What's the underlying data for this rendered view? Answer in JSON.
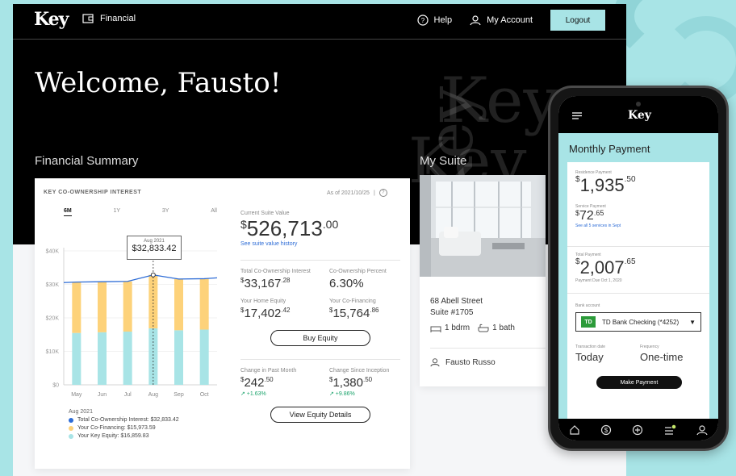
{
  "nav": {
    "logo": "Key",
    "section": "Financial",
    "help": "Help",
    "account": "My Account",
    "logout": "Logout"
  },
  "welcome": "Welcome, Fausto!",
  "watermark": "Key",
  "financial_summary": {
    "title": "Financial Summary",
    "chart_title": "KEY CO-OWNERSHIP INTEREST",
    "as_of": "As of 2021/10/25",
    "separator": "|",
    "info_icon": "?",
    "tabs": [
      "6M",
      "1Y",
      "3Y",
      "All"
    ],
    "active_tab": "6M",
    "tooltip": {
      "date": "Aug 2021",
      "value": "$32,833.42"
    },
    "legend": {
      "title": "Aug 2021",
      "items": [
        "Total Co-Ownership Interest: $32,833.42",
        "Your Co-Financing: $15,973.59",
        "Your Key Equity: $16,859.83"
      ]
    },
    "current_suite_value": {
      "label": "Current Suite Value",
      "dollar": "$",
      "whole": "526,713",
      "cents": ".00",
      "link": "See suite value history"
    },
    "total_co_ownership_interest": {
      "label": "Total Co-Ownership Interest",
      "dollar": "$",
      "whole": "33,167",
      "cents": ".28"
    },
    "co_ownership_percent": {
      "label": "Co-Ownership Percent",
      "value": "6.30%"
    },
    "your_home_equity": {
      "label": "Your Home Equity",
      "dollar": "$",
      "whole": "17,402",
      "cents": ".42"
    },
    "your_co_financing": {
      "label": "Your Co-Financing",
      "dollar": "$",
      "whole": "15,764",
      "cents": ".86"
    },
    "buy_equity_label": "Buy Equity",
    "change_past_month": {
      "label": "Change in Past Month",
      "dollar": "$",
      "whole": "242",
      "cents": ".50",
      "change": "↗ +1.63%"
    },
    "change_since_inception": {
      "label": "Change Since Inception",
      "dollar": "$",
      "whole": "1,380",
      "cents": ".50",
      "change": "↗ +9.86%"
    },
    "view_equity_label": "View Equity Details"
  },
  "chart_data": {
    "type": "bar",
    "categories": [
      "May",
      "Jun",
      "Jul",
      "Aug",
      "Sep",
      "Oct"
    ],
    "series": [
      {
        "name": "Your Key Equity",
        "values": [
          15500,
          15700,
          15900,
          16859.83,
          16300,
          16500
        ]
      },
      {
        "name": "Your Co-Financing",
        "values": [
          15200,
          15100,
          15000,
          15973.59,
          15300,
          15200
        ]
      },
      {
        "name": "Total Co-Ownership Interest",
        "values": [
          30700,
          30800,
          30900,
          32833.42,
          31600,
          31700
        ]
      }
    ],
    "y_ticks": [
      "$0",
      "$10K",
      "$20K",
      "$30K",
      "$40K"
    ],
    "ylim": [
      0,
      40000
    ],
    "colors": {
      "key_equity": "#a8e4e6",
      "co_financing": "#fdd27a",
      "total": "#2d6cd6"
    },
    "highlight": "Aug"
  },
  "suite": {
    "title": "My Suite",
    "address_line1": "68 Abell Street",
    "address_line2": "Suite #1705",
    "bedrooms": "1 bdrm",
    "bathrooms": "1 bath",
    "owner": "Fausto Russo"
  },
  "phone": {
    "logo": "Key",
    "title": "Monthly Payment",
    "residence": {
      "label": "Residence Payment",
      "dollar": "$",
      "whole": "1,935",
      "cents": ".50"
    },
    "service": {
      "label": "Service Payment",
      "dollar": "$",
      "whole": "72",
      "cents": ".65",
      "link": "See all 5 services in Sept"
    },
    "total": {
      "label": "Total Payment",
      "dollar": "$",
      "whole": "2,007",
      "cents": ".65",
      "due": "Payment Due Oct 1, 2020"
    },
    "bank_label": "Bank account",
    "bank_logo": "TD",
    "bank_value": "TD Bank Checking (*4252)",
    "caret": "▼",
    "transaction_label": "Transaction date",
    "transaction_value": "Today",
    "frequency_label": "Frequency",
    "frequency_value": "One-time",
    "button": "Make Payment"
  }
}
